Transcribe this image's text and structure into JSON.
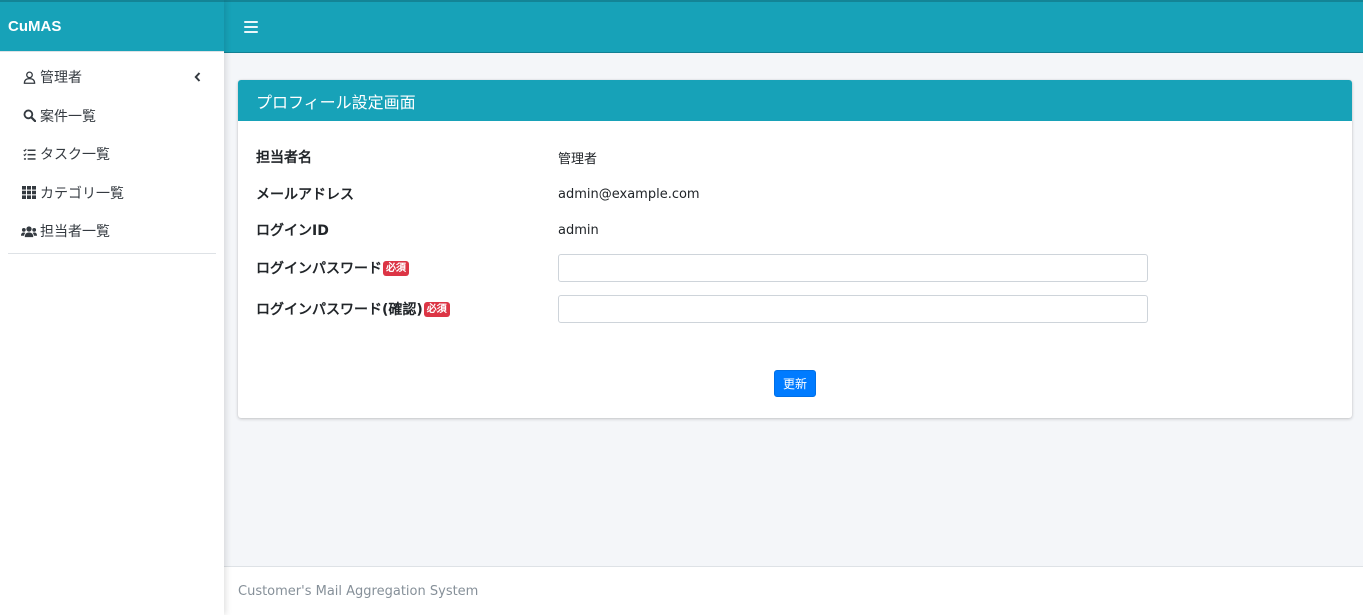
{
  "brand": {
    "name": "CuMAS"
  },
  "sidebar": {
    "items": [
      {
        "label": "管理者",
        "icon": "user-icon",
        "has_chevron": true
      },
      {
        "label": "案件一覧",
        "icon": "search-icon"
      },
      {
        "label": "タスク一覧",
        "icon": "task-list-icon"
      },
      {
        "label": "カテゴリ一覧",
        "icon": "grid-icon"
      },
      {
        "label": "担当者一覧",
        "icon": "users-icon"
      }
    ]
  },
  "topbar": {
    "menu_icon": "hamburger-icon"
  },
  "card": {
    "title": "プロフィール設定画面",
    "rows": {
      "name": {
        "label": "担当者名",
        "value": "管理者"
      },
      "email": {
        "label": "メールアドレス",
        "value": "admin@example.com"
      },
      "login_id": {
        "label": "ログインID",
        "value": "admin"
      },
      "password": {
        "label": "ログインパスワード",
        "badge": "必須",
        "value": "",
        "placeholder": ""
      },
      "password_confirm": {
        "label": "ログインパスワード(確認)",
        "badge": "必須",
        "value": "",
        "placeholder": ""
      }
    },
    "submit_label": "更新"
  },
  "footer": {
    "text": "Customer's Mail Aggregation System"
  },
  "colors": {
    "primary": "#17a2b8",
    "button": "#007bff",
    "badge": "#dc3545"
  }
}
